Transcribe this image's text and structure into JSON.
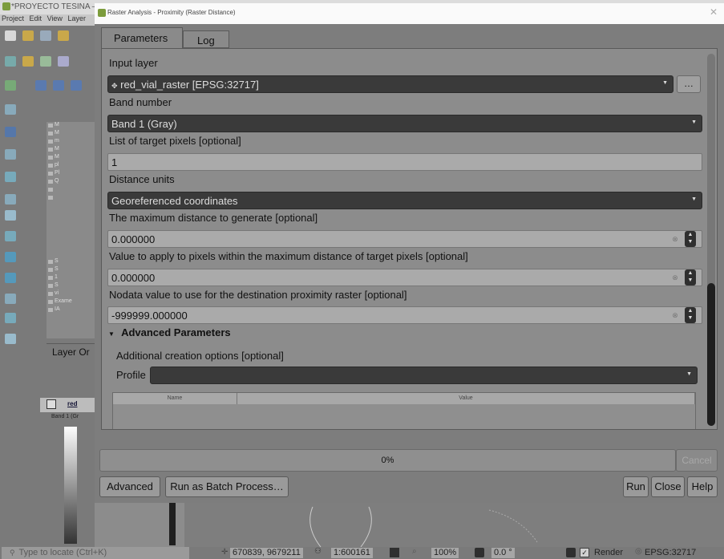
{
  "main_window": {
    "title": "*PROYECTO TESINA — QGI",
    "menu": [
      "Project",
      "Edit",
      "View",
      "Layer"
    ],
    "layer_order_tab": "Layer Or",
    "tree_items": [
      "M",
      "M",
      "m",
      "M",
      "M",
      "pl",
      "Pl",
      "Q",
      "",
      "",
      "S",
      "S",
      "1",
      "S",
      "vi",
      "Exame",
      "IA"
    ],
    "layer_panel": {
      "layer_name": "red",
      "band": "Band 1 (Gr"
    }
  },
  "dialog": {
    "title": "Raster Analysis - Proximity (Raster Distance)",
    "close_glyph": "✕",
    "tabs": {
      "parameters": "Parameters",
      "log": "Log"
    },
    "input_layer": {
      "label": "Input layer",
      "value": "red_vial_raster [EPSG:32717]",
      "browse": "…"
    },
    "band_number": {
      "label": "Band number",
      "value": "Band 1 (Gray)"
    },
    "target_pixels": {
      "label": "List of target pixels [optional]",
      "value": "1"
    },
    "distance_units": {
      "label": "Distance units",
      "value": "Georeferenced coordinates"
    },
    "max_distance": {
      "label": "The maximum distance to generate [optional]",
      "value": "0.000000"
    },
    "replace_value": {
      "label": "Value to apply to pixels within the maximum distance of target pixels [optional]",
      "value": "0.000000"
    },
    "nodata_value": {
      "label": "Nodata value to use for the destination proximity raster [optional]",
      "value": "-999999.000000"
    },
    "advanced": {
      "header": "Advanced Parameters",
      "creation_options_label": "Additional creation options [optional]",
      "profile_label": "Profile",
      "profile_value": "",
      "table_columns": [
        "Name",
        "Value"
      ]
    },
    "progress": {
      "text": "0%",
      "value": 0
    },
    "buttons": {
      "cancel": "Cancel",
      "advanced": "Advanced",
      "batch": "Run as Batch Process…",
      "run": "Run",
      "close": "Close",
      "help": "Help"
    }
  },
  "statusbar": {
    "locate_placeholder": "Type to locate (Ctrl+K)",
    "coordinate": "670839, 9679211",
    "scale": "1:600161",
    "magnifier": "100%",
    "rotation": "0.0 °",
    "render_label": "Render",
    "crs": "EPSG:32717"
  },
  "colors": {
    "dialog_bg": "#7d7d7d",
    "dark_combo": "#3a3a3a",
    "field_bg": "#aaaaaa"
  }
}
